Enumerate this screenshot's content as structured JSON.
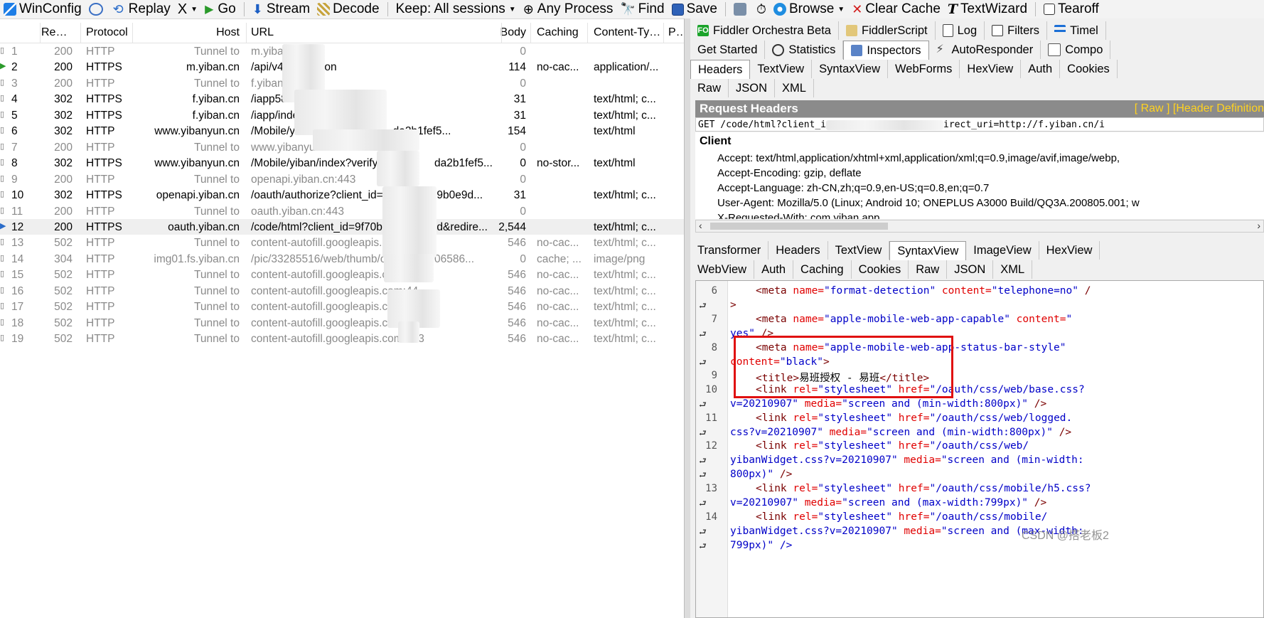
{
  "toolbar": {
    "items": [
      "WinConfig",
      "Replay",
      "Go",
      "Stream",
      "Decode",
      "Keep: All sessions",
      "Any Process",
      "Find",
      "Save",
      "Browse",
      "Clear Cache",
      "TextWizard",
      "Tearoff"
    ],
    "remove_symbol": "X"
  },
  "sessions": {
    "columns": [
      "Result",
      "Protocol",
      "Host",
      "URL",
      "Body",
      "Caching",
      "Content-Type",
      "Pro"
    ],
    "rows": [
      {
        "num": "1",
        "result": "200",
        "protocol": "HTTP",
        "host": "Tunnel to",
        "url": "m.yiban",
        "body": "0",
        "caching": "",
        "ctype": ""
      },
      {
        "num": "2",
        "result": "200",
        "protocol": "HTTPS",
        "host": "m.yiban.cn",
        "url": "/api/v4/",
        "url_tail": "ation",
        "body": "114",
        "caching": "no-cac...",
        "ctype": "application/..."
      },
      {
        "num": "3",
        "result": "200",
        "protocol": "HTTP",
        "host": "Tunnel to",
        "url": "f.yiban.c",
        "body": "0",
        "caching": "",
        "ctype": ""
      },
      {
        "num": "4",
        "result": "302",
        "protocol": "HTTPS",
        "host": "f.yiban.cn",
        "url": "/iapp5876",
        "body": "31",
        "caching": "",
        "ctype": "text/html; c..."
      },
      {
        "num": "5",
        "result": "302",
        "protocol": "HTTPS",
        "host": "f.yiban.cn",
        "url": "/iapp/index.",
        "body": "31",
        "caching": "",
        "ctype": "text/html; c..."
      },
      {
        "num": "6",
        "result": "302",
        "protocol": "HTTP",
        "host": "www.yibanyun.cn",
        "url": "/Mobile/yiban/index?v",
        "url_tail": "da2b1fef5...",
        "body": "154",
        "caching": "",
        "ctype": "text/html"
      },
      {
        "num": "7",
        "result": "200",
        "protocol": "HTTP",
        "host": "Tunnel to",
        "url": "www.yibanyun.cn:443",
        "body": "0",
        "caching": "",
        "ctype": ""
      },
      {
        "num": "8",
        "result": "302",
        "protocol": "HTTPS",
        "host": "www.yibanyun.cn",
        "url": "/Mobile/yiban/index?verify_re",
        "url_tail": "da2b1fef5...",
        "body": "0",
        "caching": "no-stor...",
        "ctype": "text/html"
      },
      {
        "num": "9",
        "result": "200",
        "protocol": "HTTP",
        "host": "Tunnel to",
        "url": "openapi.yiban.cn:443",
        "body": "0",
        "caching": "",
        "ctype": ""
      },
      {
        "num": "10",
        "result": "302",
        "protocol": "HTTPS",
        "host": "openapi.yiban.cn",
        "url": "/oauth/authorize?client_id=9",
        "url_tail": "b9b0e9d...",
        "body": "31",
        "caching": "",
        "ctype": "text/html; c..."
      },
      {
        "num": "11",
        "result": "200",
        "protocol": "HTTP",
        "host": "Tunnel to",
        "url": "oauth.yiban.cn:443",
        "body": "0",
        "caching": "",
        "ctype": ""
      },
      {
        "num": "12",
        "result": "200",
        "protocol": "HTTPS",
        "host": "oauth.yiban.cn",
        "url": "/code/html?client_id=9f70b0f",
        "url_tail": "9d&redire...",
        "body": "2,544",
        "caching": "",
        "ctype": "text/html; c..."
      },
      {
        "num": "13",
        "result": "502",
        "protocol": "HTTP",
        "host": "Tunnel to",
        "url": "content-autofill.googleapis.co",
        "body": "546",
        "caching": "no-cac...",
        "ctype": "text/html; c..."
      },
      {
        "num": "14",
        "result": "304",
        "protocol": "HTTP",
        "host": "img01.fs.yiban.cn",
        "url": "/pic/33285516/web/thumb/open/",
        "url_tail": "06586...",
        "body": "0",
        "caching": "cache; ...",
        "ctype": "image/png"
      },
      {
        "num": "15",
        "result": "502",
        "protocol": "HTTP",
        "host": "Tunnel to",
        "url": "content-autofill.googleapis.com:4",
        "body": "546",
        "caching": "no-cac...",
        "ctype": "text/html; c..."
      },
      {
        "num": "16",
        "result": "502",
        "protocol": "HTTP",
        "host": "Tunnel to",
        "url": "content-autofill.googleapis.com:44",
        "body": "546",
        "caching": "no-cac...",
        "ctype": "text/html; c..."
      },
      {
        "num": "17",
        "result": "502",
        "protocol": "HTTP",
        "host": "Tunnel to",
        "url": "content-autofill.googleapis.com:443",
        "body": "546",
        "caching": "no-cac...",
        "ctype": "text/html; c..."
      },
      {
        "num": "18",
        "result": "502",
        "protocol": "HTTP",
        "host": "Tunnel to",
        "url": "content-autofill.googleapis.com:443",
        "body": "546",
        "caching": "no-cac...",
        "ctype": "text/html; c..."
      },
      {
        "num": "19",
        "result": "502",
        "protocol": "HTTP",
        "host": "Tunnel to",
        "url": "content-autofill.googleapis.com:443",
        "body": "546",
        "caching": "no-cac...",
        "ctype": "text/html; c..."
      }
    ]
  },
  "right": {
    "top_tabs": [
      "Fiddler Orchestra Beta",
      "FiddlerScript",
      "Log",
      "Filters",
      "Timel"
    ],
    "main_tabs": [
      "Get Started",
      "Statistics",
      "Inspectors",
      "AutoResponder",
      "Compo"
    ],
    "request_tabs_1": [
      "Headers",
      "TextView",
      "SyntaxView",
      "WebForms",
      "HexView",
      "Auth",
      "Cookies"
    ],
    "request_tabs_2": [
      "Raw",
      "JSON",
      "XML"
    ],
    "request_headers_title": "Request Headers",
    "request_headers_links": "[ Raw ]   [Header Definition",
    "request_line_left": "GET /code/html?client_i",
    "request_line_right": "irect_uri=http://f.yiban.cn/i",
    "client_group": "Client",
    "header_lines": [
      "Accept: text/html,application/xhtml+xml,application/xml;q=0.9,image/avif,image/webp,",
      "Accept-Encoding: gzip, deflate",
      "Accept-Language: zh-CN,zh;q=0.9,en-US;q=0.8,en;q=0.7",
      "User-Agent: Mozilla/5.0 (Linux; Android 10; ONEPLUS A3000 Build/QQ3A.200805.001; w",
      "X-Requested-With: com.yiban.app"
    ],
    "response_tabs_1": [
      "Transformer",
      "Headers",
      "TextView",
      "SyntaxView",
      "ImageView",
      "HexView"
    ],
    "response_tabs_2": [
      "WebView",
      "Auth",
      "Caching",
      "Cookies",
      "Raw",
      "JSON",
      "XML"
    ],
    "line_numbers": [
      "6",
      "7",
      "8",
      "9",
      "10",
      "11",
      "12",
      "13",
      "14"
    ],
    "code": {
      "l6a": "<meta",
      "l6b": " name=",
      "l6c": "\"format-detection\"",
      "l6d": " content=",
      "l6e": "\"telephone=no\"",
      "l6f": " /",
      "l6g": ">",
      "l7a": "<meta",
      "l7b": " name=",
      "l7c": "\"apple-mobile-web-app-capable\"",
      "l7d": " content=",
      "l7e": "\"",
      "l7f": "yes\"",
      "l7g": " />",
      "l8a": "<meta",
      "l8b": " name=",
      "l8c": "\"apple-mobile-web-app-status-bar-style\"",
      "l8d": "content=",
      "l8e": "\"black\"",
      "l8f": ">",
      "l9a": "<title>",
      "l9b": "易班授权 - 易班",
      "l9c": "</title>",
      "l10a": "<link",
      "l10b": " rel=",
      "l10c": "\"stylesheet\"",
      "l10d": " href=",
      "l10e": "\"/oauth/css/web/base.css?",
      "l10f": "v=20210907\"",
      "l10g": " media=",
      "l10h": "\"screen and (min-width:800px)\"",
      "l10i": " />",
      "l11a": "<link",
      "l11b": " rel=",
      "l11c": "\"stylesheet\"",
      "l11d": " href=",
      "l11e": "\"/oauth/css/web/logged.",
      "l11f": "css?v=20210907\"",
      "l11g": " media=",
      "l11h": "\"screen and (min-width:800px)\"",
      "l11i": " />",
      "l12a": "<link",
      "l12b": " rel=",
      "l12c": "\"stylesheet\"",
      "l12d": " href=",
      "l12e": "\"/oauth/css/web/",
      "l12f": "yibanWidget.css?v=20210907\"",
      "l12g": " media=",
      "l12h": "\"screen and (min-width:",
      "l12i": "800px)\"",
      "l12j": " />",
      "l13a": "<link",
      "l13b": " rel=",
      "l13c": "\"stylesheet\"",
      "l13d": " href=",
      "l13e": "\"/oauth/css/mobile/h5.css?",
      "l13f": "v=20210907\"",
      "l13g": " media=",
      "l13h": "\"screen and (max-width:799px)\"",
      "l13i": " />",
      "l14a": "<link",
      "l14b": " rel=",
      "l14c": "\"stylesheet\"",
      "l14d": " href=",
      "l14e": "\"/oauth/css/mobile/",
      "l14f": "yibanWidget.css?v=20210907\"",
      "l14g": " media=",
      "l14h": "\"screen and (max-width:",
      "l15": "799px)\" />"
    },
    "watermark": "CSDN @搭老板2"
  },
  "colors": {
    "accent_red": "#e01010",
    "tag": "#7a0000",
    "attr": "#e00000",
    "value": "#0000c8"
  }
}
